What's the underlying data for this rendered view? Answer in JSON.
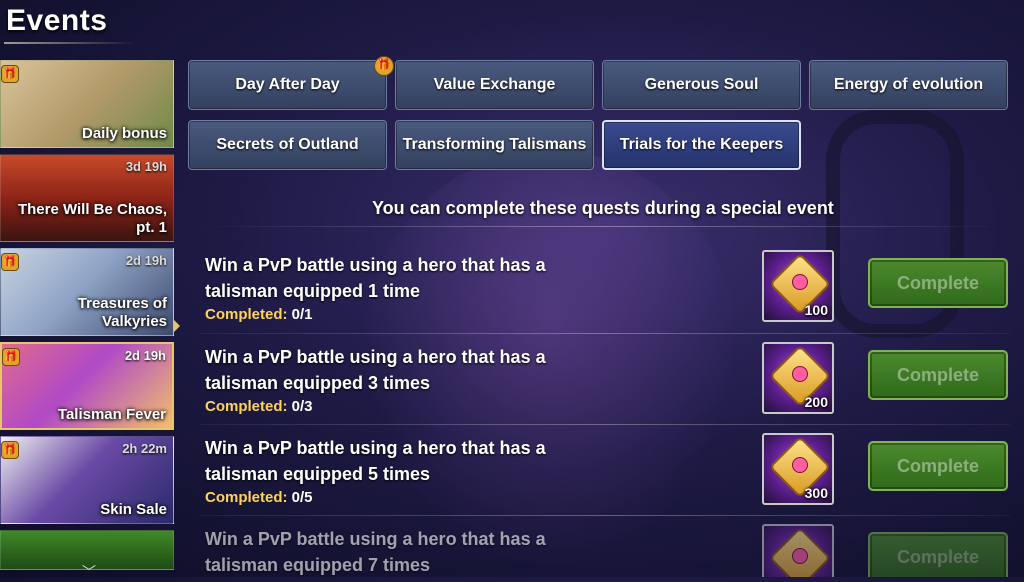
{
  "header": {
    "title": "Events"
  },
  "sidebar": {
    "items": [
      {
        "label": "Daily bonus",
        "timer": "",
        "gift": true
      },
      {
        "label": "There Will Be Chaos, pt. 1",
        "timer": "3d 19h",
        "gift": false
      },
      {
        "label": "Treasures of Valkyries",
        "timer": "2d 19h",
        "gift": true
      },
      {
        "label": "Talisman Fever",
        "timer": "2d 19h",
        "gift": true,
        "active": true
      },
      {
        "label": "Skin Sale",
        "timer": "2h 22m",
        "gift": true
      },
      {
        "label": "",
        "timer": "",
        "gift": false
      }
    ]
  },
  "tabs": [
    {
      "label": "Day After Day"
    },
    {
      "label": "Value Exchange"
    },
    {
      "label": "Generous Soul"
    },
    {
      "label": "Energy of evolution"
    },
    {
      "label": "Secrets of Outland"
    },
    {
      "label": "Transforming Talismans"
    },
    {
      "label": "Trials for the Keepers",
      "active": true
    }
  ],
  "main": {
    "subtitle": "You can complete these quests during a special event",
    "completed_label": "Completed:",
    "complete_button": "Complete",
    "quests": [
      {
        "line1": "Win a PvP battle using a hero that has a",
        "line2": "talisman equipped 1 time",
        "progress": "0/1",
        "reward": "100"
      },
      {
        "line1": "Win a PvP battle using a hero that has a",
        "line2": "talisman equipped 3 times",
        "progress": "0/3",
        "reward": "200"
      },
      {
        "line1": "Win a PvP battle using a hero that has a",
        "line2": "talisman equipped 5 times",
        "progress": "0/5",
        "reward": "300"
      },
      {
        "line1": "Win a PvP battle using a hero that has a",
        "line2": "talisman equipped 7 times",
        "progress": "",
        "reward": ""
      }
    ]
  },
  "icons": {
    "gift": "gift-icon",
    "scroll": "chevron-down-icon",
    "reward": "talisman-chest-icon"
  }
}
